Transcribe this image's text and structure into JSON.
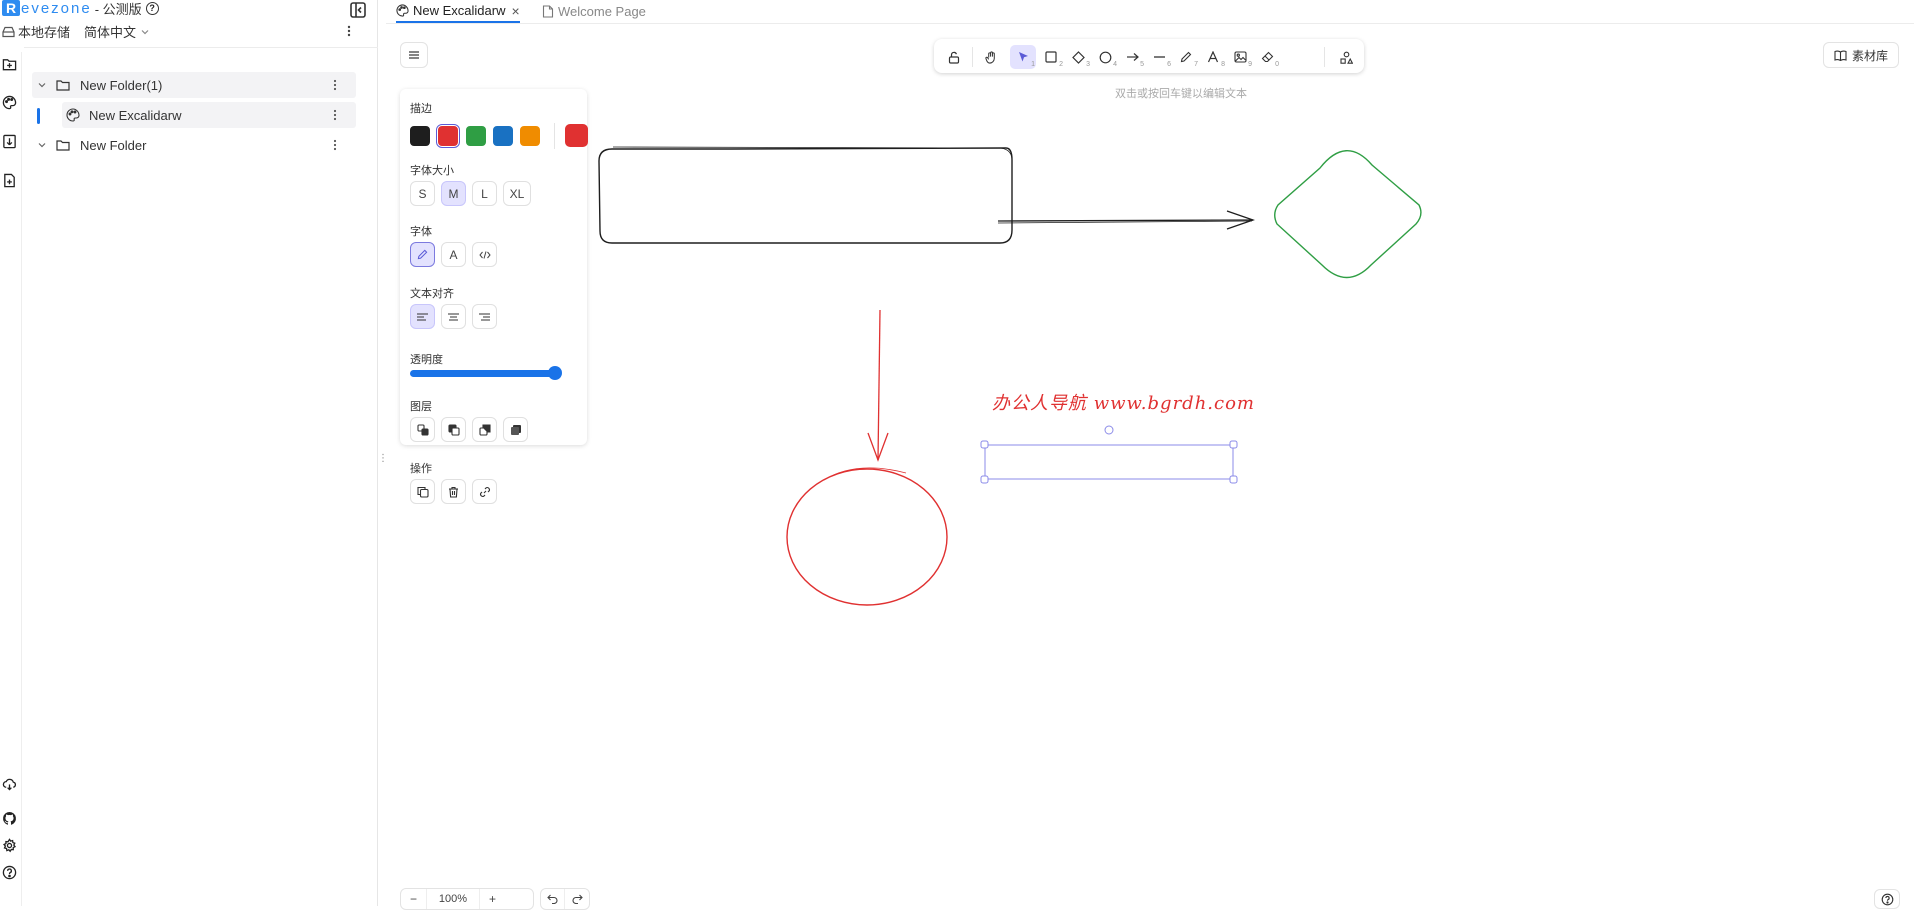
{
  "brand": {
    "logo_letter": "R",
    "name": "evezone",
    "subtitle": "- 公测版",
    "help": "?"
  },
  "sidebar": {
    "storage_label": "本地存储",
    "language": "简体中文",
    "tree": [
      {
        "label": "New Folder(1)",
        "type": "folder",
        "expanded": true
      },
      {
        "label": "New Excalidarw",
        "type": "board",
        "active": true
      },
      {
        "label": "New Folder",
        "type": "folder",
        "expanded": true
      }
    ]
  },
  "tabs": [
    {
      "label": "New Excalidarw",
      "active": true,
      "close": "×"
    },
    {
      "label": "Welcome Page",
      "active": false
    }
  ],
  "toolbar": {
    "keys": [
      "1",
      "2",
      "3",
      "4",
      "5",
      "6",
      "7",
      "8",
      "9",
      "0"
    ],
    "hint": "双击或按回车键以编辑文本",
    "library_label": "素材库"
  },
  "props": {
    "stroke_label": "描边",
    "stroke_colors": [
      "#1e1e1e",
      "#e03131",
      "#2f9e44",
      "#1971c2",
      "#f08c00"
    ],
    "stroke_selected": "#e03131",
    "font_size_label": "字体大小",
    "font_sizes": [
      "S",
      "M",
      "L",
      "XL"
    ],
    "font_size_selected": "M",
    "font_family_label": "字体",
    "font_family_letter": "A",
    "align_label": "文本对齐",
    "opacity_label": "透明度",
    "opacity": 100,
    "layers_label": "图层",
    "actions_label": "操作"
  },
  "canvas": {
    "selected_text": "办公人导航 www.bgrdh.com",
    "shape_colors": {
      "rect": "#1e1e1e",
      "arrow_right": "#1e1e1e",
      "diamond": "#2f9e44",
      "arrow_down": "#e03131",
      "ellipse": "#e03131",
      "selection": "#8b8be8"
    }
  },
  "footer": {
    "zoom_out": "−",
    "zoom_level": "100%",
    "zoom_in": "+",
    "help": "?"
  }
}
